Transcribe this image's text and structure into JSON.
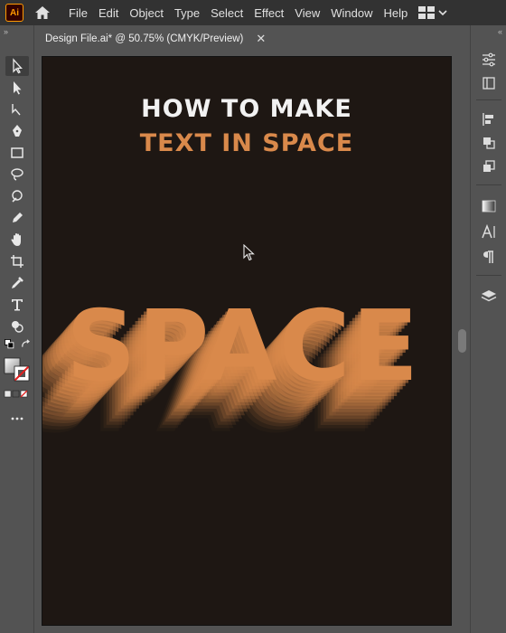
{
  "app": {
    "logo_text": "Ai"
  },
  "menu": [
    "File",
    "Edit",
    "Object",
    "Type",
    "Select",
    "Effect",
    "View",
    "Window",
    "Help"
  ],
  "document": {
    "tab_title": "Design File.ai* @ 50.75% (CMYK/Preview)",
    "close_glyph": "✕"
  },
  "artboard": {
    "heading_line1": "HOW TO MAKE",
    "heading_line2": "TEXT IN SPACE",
    "big_word": "SPACE"
  },
  "colors": {
    "artboard_bg": "#1e1713",
    "accent_orange": "#d9894b",
    "heading_white": "#f2f2f2",
    "ui_dark": "#323232",
    "ui_mid": "#535353"
  },
  "icons": {
    "left_tools": [
      "selection-tool-icon",
      "direct-selection-tool-icon",
      "curvature-tool-icon",
      "pen-tool-icon",
      "rectangle-tool-icon",
      "lasso-tool-icon",
      "blob-brush-tool-icon",
      "pencil-tool-icon",
      "hand-tool-icon",
      "artboard-tool-icon",
      "eyedropper-tool-icon",
      "type-tool-icon",
      "shape-builder-tool-icon",
      "default-colors-icon",
      "swap-colors-icon",
      "fill-swatch-icon",
      "stroke-swatch-icon",
      "color-mode-icon",
      "more-tools-icon"
    ],
    "right_panels": [
      "properties-panel-icon",
      "libraries-panel-icon",
      "align-panel-icon",
      "pathfinder-panel-icon",
      "transform-panel-icon",
      "gradient-panel-icon",
      "character-panel-icon",
      "paragraph-panel-icon",
      "layers-panel-icon"
    ]
  }
}
